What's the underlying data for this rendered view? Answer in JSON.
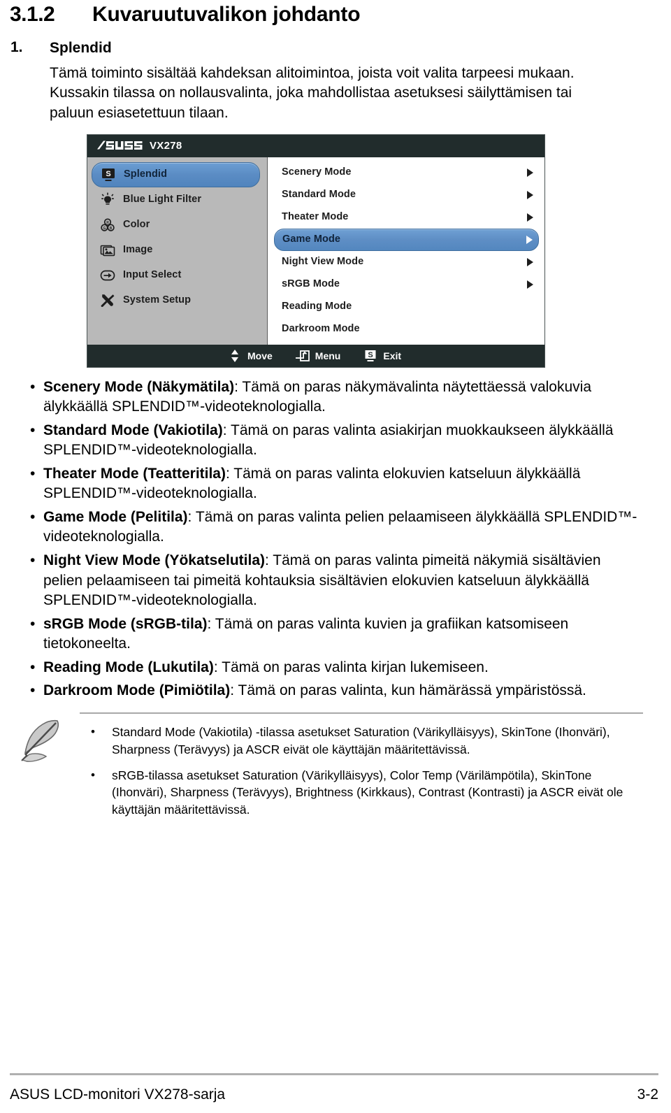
{
  "heading": {
    "number": "3.1.2",
    "title": "Kuvaruutuvalikon johdanto"
  },
  "item": {
    "marker": "1.",
    "title": "Splendid",
    "paragraph": "Tämä toiminto sisältää kahdeksan alitoimintoa, joista voit valita tarpeesi mukaan. Kussakin tilassa on nollausvalinta, joka mahdollistaa asetuksesi säilyttämisen tai paluun esiasetettuun tilaan."
  },
  "osd": {
    "brand": "ASUS",
    "model": "VX278",
    "colors": {
      "titlebar": "#212c2c",
      "sidebar": "#b9b9b9",
      "panel": "#ffffff",
      "highlight": "#5b8cc4",
      "highlight_border": "#3f6e9e"
    },
    "sidebar": [
      {
        "label": "Splendid",
        "icon": "splendid-monitor-icon",
        "selected": true
      },
      {
        "label": "Blue Light Filter",
        "icon": "lightbulb-icon",
        "selected": false
      },
      {
        "label": "Color",
        "icon": "color-circles-icon",
        "selected": false
      },
      {
        "label": "Image",
        "icon": "picture-icon",
        "selected": false
      },
      {
        "label": "Input Select",
        "icon": "input-arrow-icon",
        "selected": false
      },
      {
        "label": "System Setup",
        "icon": "tools-icon",
        "selected": false
      }
    ],
    "modes": [
      {
        "label": "Scenery Mode",
        "arrow": true,
        "selected": false
      },
      {
        "label": "Standard Mode",
        "arrow": true,
        "selected": false
      },
      {
        "label": "Theater Mode",
        "arrow": true,
        "selected": false
      },
      {
        "label": "Game Mode",
        "arrow": true,
        "selected": true
      },
      {
        "label": "Night View Mode",
        "arrow": true,
        "selected": false
      },
      {
        "label": "sRGB Mode",
        "arrow": true,
        "selected": false
      },
      {
        "label": "Reading Mode",
        "arrow": false,
        "selected": false
      },
      {
        "label": "Darkroom Mode",
        "arrow": false,
        "selected": false
      }
    ],
    "footer": [
      {
        "label": "Move",
        "icon": "up-down-arrows-icon"
      },
      {
        "label": "Menu",
        "icon": "enter-menu-icon"
      },
      {
        "label": "Exit",
        "icon": "splendid-s-icon"
      }
    ]
  },
  "bullets": [
    {
      "bold": "Scenery Mode (Näkymätila)",
      "rest": ": Tämä on paras näkymävalinta näytettäessä valokuvia älykkäällä SPLENDID™-videoteknologialla."
    },
    {
      "bold": "Standard Mode (Vakiotila)",
      "rest": ": Tämä on paras valinta asiakirjan muokkaukseen älykkäällä SPLENDID™-videoteknologialla."
    },
    {
      "bold": "Theater Mode (Teatteritila)",
      "rest": ": Tämä on paras valinta elokuvien katseluun älykkäällä SPLENDID™-videoteknologialla."
    },
    {
      "bold": "Game Mode (Pelitila)",
      "rest": ": Tämä on paras valinta pelien pelaamiseen älykkäällä SPLENDID™-videoteknologialla."
    },
    {
      "bold": "Night View Mode (Yökatselutila)",
      "rest": ": Tämä on paras valinta pimeitä näkymiä sisältävien pelien pelaamiseen tai pimeitä kohtauksia sisältävien elokuvien katseluun älykkäällä SPLENDID™-videoteknologialla."
    },
    {
      "bold": "sRGB Mode (sRGB-tila)",
      "rest": ": Tämä on paras valinta kuvien ja grafiikan katsomiseen tietokoneelta."
    },
    {
      "bold": "Reading Mode (Lukutila)",
      "rest": ": Tämä on paras valinta kirjan lukemiseen."
    },
    {
      "bold": "Darkroom Mode (Pimiötila)",
      "rest": ": Tämä on paras valinta, kun hämärässä ympäristössä."
    }
  ],
  "bullet_marker": "•",
  "note": {
    "icon": "feather-note-icon",
    "items": [
      "Standard Mode (Vakiotila) -tilassa asetukset Saturation (Värikylläisyys), SkinTone (Ihonväri), Sharpness (Terävyys) ja ASCR eivät ole käyttäjän määritettävissä.",
      "sRGB-tilassa asetukset Saturation (Värikylläisyys), Color Temp (Värilämpötila), SkinTone (Ihonväri), Sharpness (Terävyys), Brightness (Kirkkaus), Contrast (Kontrasti) ja ASCR eivät ole käyttäjän määritettävissä."
    ]
  },
  "footer": {
    "left": "ASUS LCD-monitori VX278-sarja",
    "right": "3-2"
  }
}
